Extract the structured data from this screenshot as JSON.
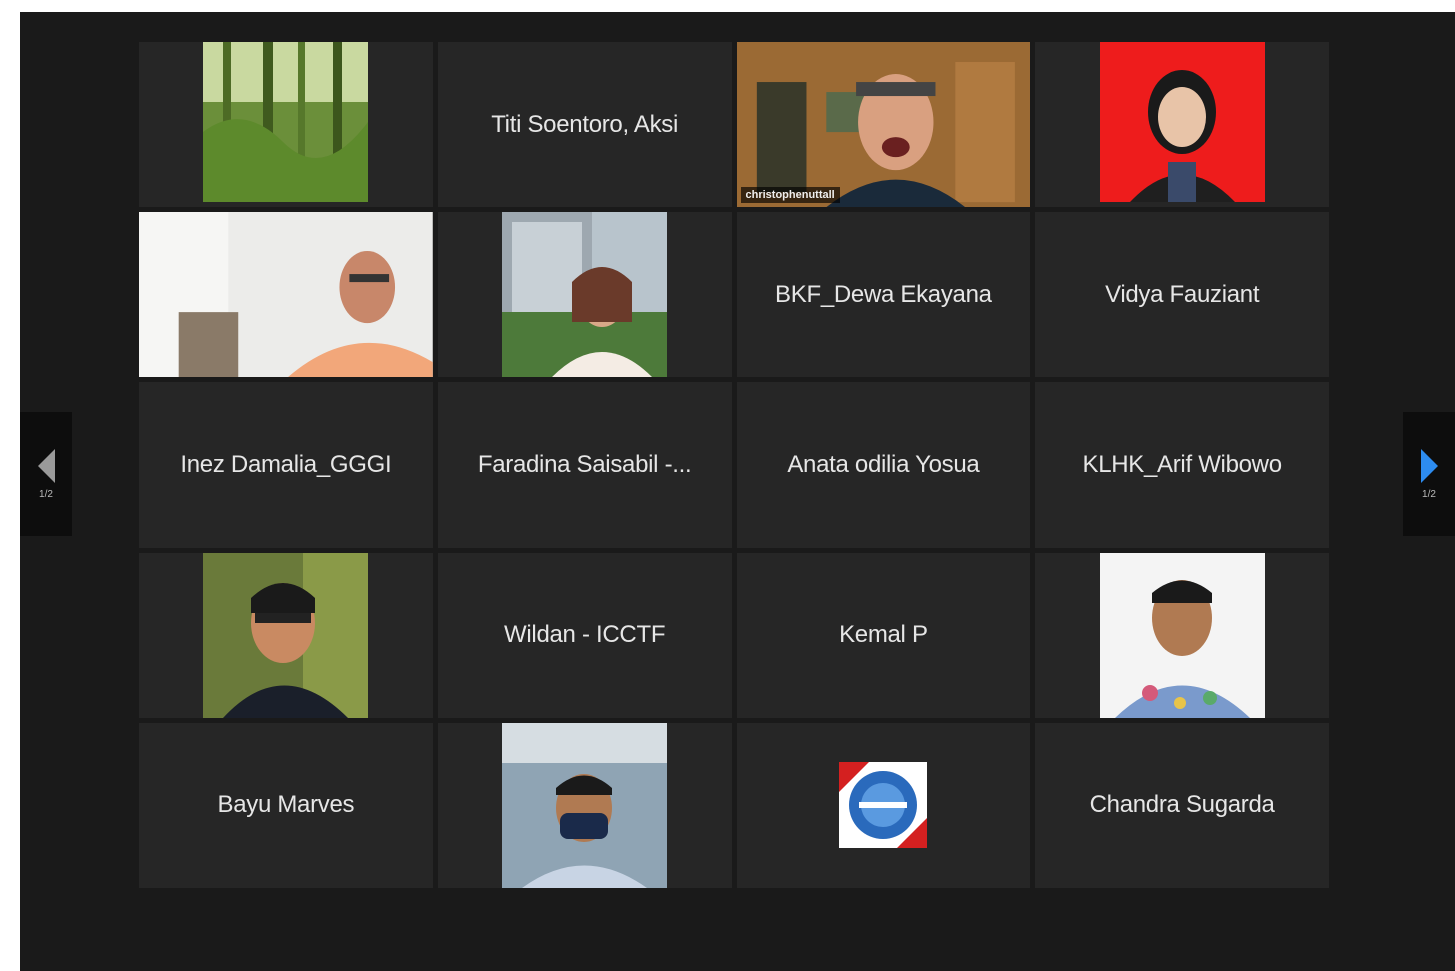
{
  "tiles": [
    {
      "type": "video",
      "name": ""
    },
    {
      "type": "name",
      "name": "Titi Soentoro, Aksi"
    },
    {
      "type": "video",
      "name": "christophenuttall",
      "active": true
    },
    {
      "type": "video",
      "name": ""
    },
    {
      "type": "video",
      "name": ""
    },
    {
      "type": "video",
      "name": ""
    },
    {
      "type": "name",
      "name": "BKF_Dewa Ekayana"
    },
    {
      "type": "name",
      "name": "Vidya Fauziant"
    },
    {
      "type": "name",
      "name": "Inez Damalia_GGGI"
    },
    {
      "type": "name",
      "name": "Faradina Saisabil -..."
    },
    {
      "type": "name",
      "name": "Anata odilia Yosua"
    },
    {
      "type": "name",
      "name": "KLHK_Arif Wibowo"
    },
    {
      "type": "video",
      "name": ""
    },
    {
      "type": "name",
      "name": "Wildan - ICCTF"
    },
    {
      "type": "name",
      "name": "Kemal P"
    },
    {
      "type": "video",
      "name": ""
    },
    {
      "type": "name",
      "name": "Bayu Marves"
    },
    {
      "type": "video",
      "name": ""
    },
    {
      "type": "video",
      "name": ""
    },
    {
      "type": "name",
      "name": "Chandra Sugarda"
    }
  ],
  "nav": {
    "prev_label": "1/2",
    "next_label": "1/2"
  },
  "colors": {
    "background": "#1a1a1a",
    "tile": "#262626",
    "active_border": "#c9cf42",
    "next_arrow": "#2d8cf0"
  }
}
